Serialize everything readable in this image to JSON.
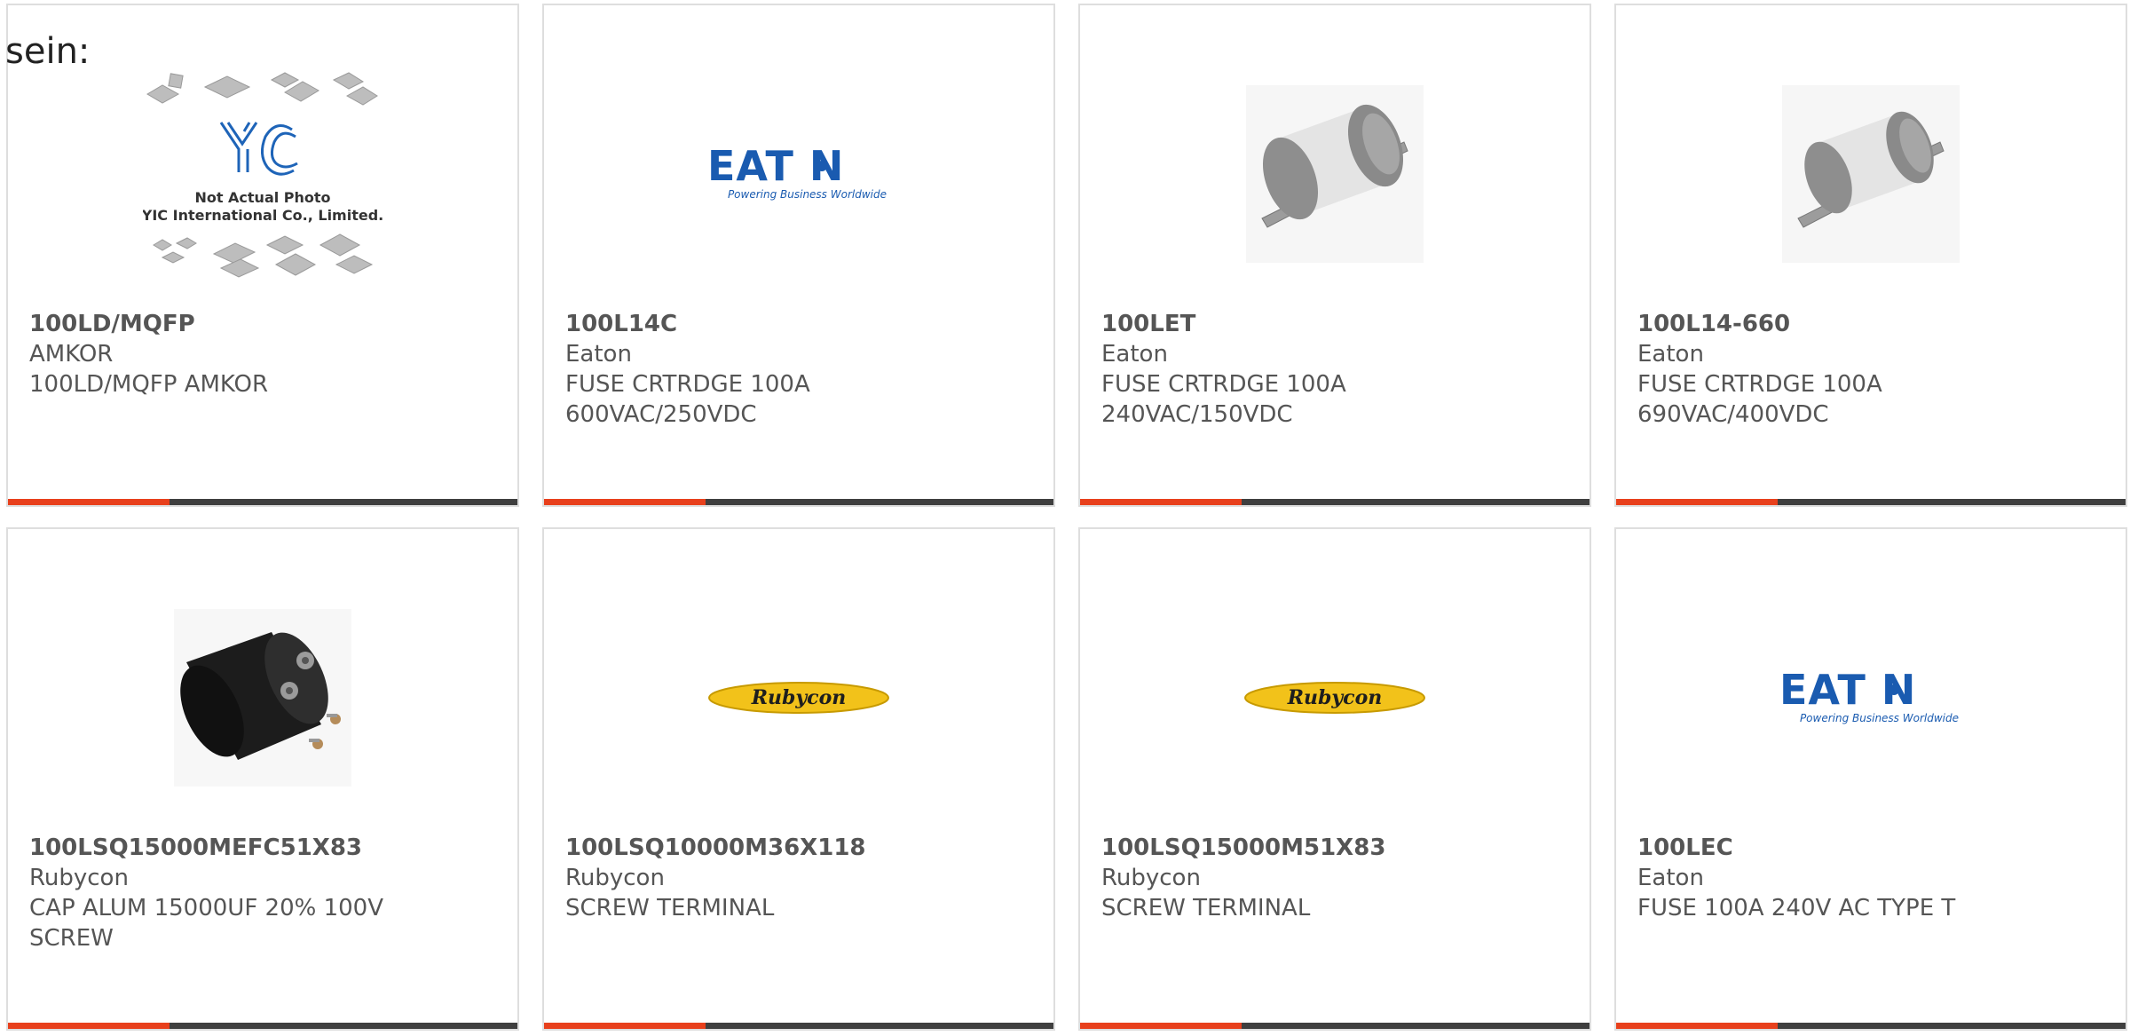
{
  "intro_text": "sein:",
  "accent_color": "#e8401c",
  "bar_color": "#3f3f3f",
  "placeholder_image": {
    "line1": "Not Actual Photo",
    "line2": "YIC International Co., Limited.",
    "logo": "YIC"
  },
  "eaton_logo": {
    "wordmark": "EAT N",
    "tagline": "Powering Business Worldwide"
  },
  "rubycon_logo": {
    "wordmark": "Rubycon"
  },
  "products": [
    {
      "part": "100LD/MQFP",
      "maker": "AMKOR",
      "desc1": "100LD/MQFP AMKOR",
      "desc2": "",
      "image": "yic-placeholder"
    },
    {
      "part": "100L14C",
      "maker": "Eaton",
      "desc1": "FUSE CRTRDGE 100A",
      "desc2": "600VAC/250VDC",
      "image": "eaton-logo"
    },
    {
      "part": "100LET",
      "maker": "Eaton",
      "desc1": "FUSE CRTRDGE 100A",
      "desc2": "240VAC/150VDC",
      "image": "fuse-photo"
    },
    {
      "part": "100L14-660",
      "maker": "Eaton",
      "desc1": "FUSE CRTRDGE 100A",
      "desc2": "690VAC/400VDC",
      "image": "fuse-photo"
    },
    {
      "part": "100LSQ15000MEFC51X83",
      "maker": "Rubycon",
      "desc1": "CAP ALUM 15000UF 20% 100V",
      "desc2": "SCREW",
      "image": "capacitor-photo"
    },
    {
      "part": "100LSQ10000M36X118",
      "maker": "Rubycon",
      "desc1": "SCREW TERMINAL",
      "desc2": "",
      "image": "rubycon-logo"
    },
    {
      "part": "100LSQ15000M51X83",
      "maker": "Rubycon",
      "desc1": "SCREW TERMINAL",
      "desc2": "",
      "image": "rubycon-logo"
    },
    {
      "part": "100LEC",
      "maker": "Eaton",
      "desc1": "FUSE 100A 240V AC TYPE T",
      "desc2": "",
      "image": "eaton-logo"
    }
  ]
}
